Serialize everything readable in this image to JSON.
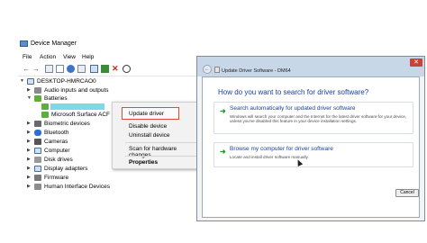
{
  "device_manager": {
    "title": "Device Manager",
    "menus": [
      "File",
      "Action",
      "View",
      "Help"
    ],
    "tree": {
      "root": "DESKTOP-HMRCAO0",
      "items": [
        {
          "label": "Audio inputs and outputs",
          "icon": "speaker-icon"
        },
        {
          "label": "Batteries",
          "icon": "battery-icon"
        },
        {
          "label": "",
          "icon": "battery-icon"
        },
        {
          "label": "Microsoft Surface ACF",
          "icon": "battery-icon"
        },
        {
          "label": "Biometric devices",
          "icon": "fingerprint-icon"
        },
        {
          "label": "Bluetooth",
          "icon": "bluetooth-icon"
        },
        {
          "label": "Cameras",
          "icon": "camera-icon"
        },
        {
          "label": "Computer",
          "icon": "computer-icon"
        },
        {
          "label": "Disk drives",
          "icon": "disk-icon"
        },
        {
          "label": "Display adapters",
          "icon": "monitor-icon"
        },
        {
          "label": "Firmware",
          "icon": "chip-icon"
        },
        {
          "label": "Human Interface Devices",
          "icon": "keyboard-icon"
        }
      ]
    },
    "context_menu": {
      "items": [
        "Update driver",
        "Disable device",
        "Uninstall device",
        "Scan for hardware changes",
        "Properties"
      ]
    }
  },
  "update_dialog": {
    "title": "Update Driver Software - DM64",
    "close_label": "✕",
    "question": "How do you want to search for driver software?",
    "options": [
      {
        "title": "Search automatically for updated driver software",
        "description": "Windows will search your computer and the Internet for the latest driver software for your device, unless you've disabled this feature in your device installation settings."
      },
      {
        "title": "Browse my computer for driver software",
        "description": "Locate and install driver software manually."
      }
    ],
    "cancel_label": "Cancel"
  },
  "colors": {
    "selection": "#7fd8ea",
    "highlight_border": "#e0483f",
    "link_blue": "#1a3e9c",
    "arrow_green": "#1f9a2b"
  }
}
